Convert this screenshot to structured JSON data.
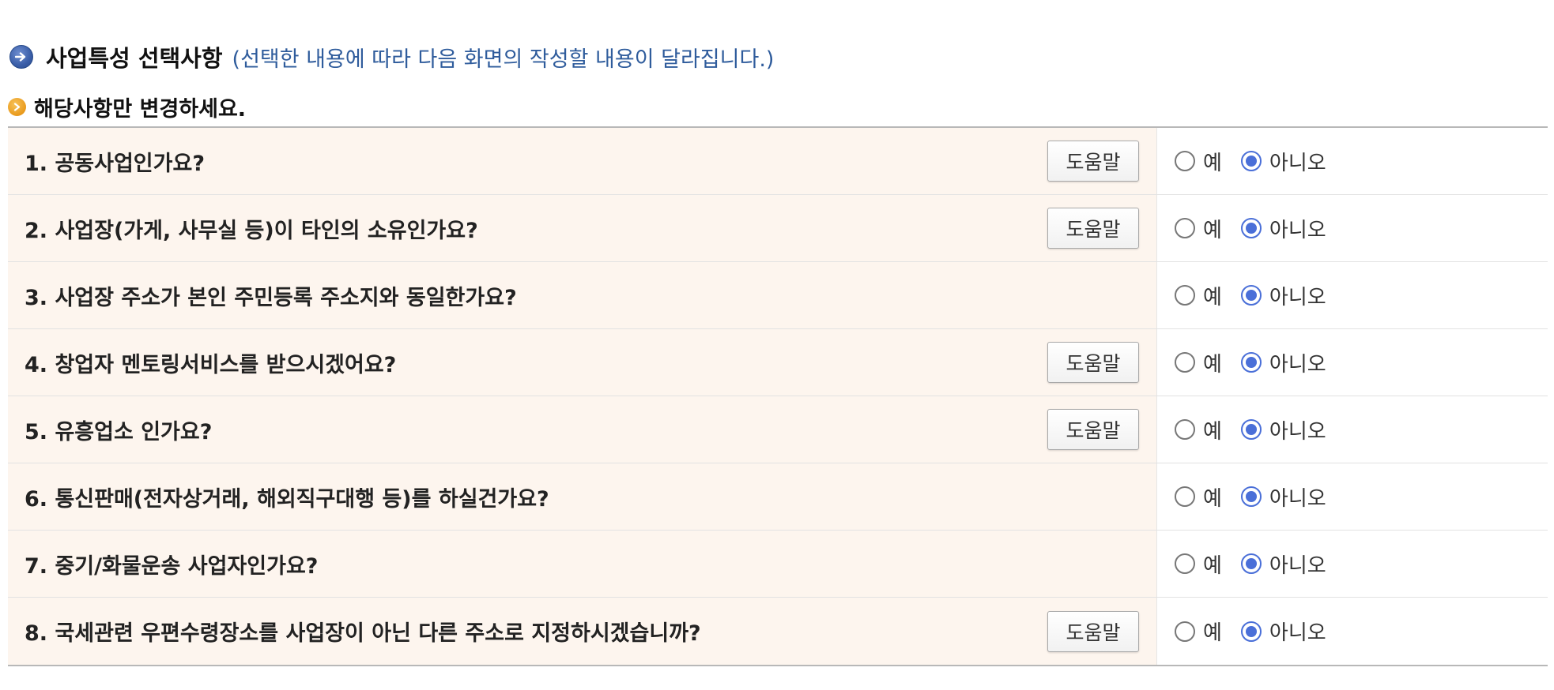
{
  "section": {
    "icon": "arrow-right-circle-icon",
    "title": "사업특성 선택사항",
    "note": "(선택한 내용에 따라 다음 화면의 작성할 내용이 달라집니다.)"
  },
  "subheading": {
    "icon": "arrow-right-dot-icon",
    "text": "해당사항만 변경하세요."
  },
  "options": {
    "yes_label": "예",
    "no_label": "아니오"
  },
  "help_label": "도움말",
  "questions": [
    {
      "text": "1. 공동사업인가요?",
      "has_help": true,
      "selected": "no"
    },
    {
      "text": "2. 사업장(가게, 사무실 등)이 타인의 소유인가요?",
      "has_help": true,
      "selected": "no"
    },
    {
      "text": "3. 사업장 주소가 본인 주민등록 주소지와 동일한가요?",
      "has_help": false,
      "selected": "no"
    },
    {
      "text": "4. 창업자 멘토링서비스를 받으시겠어요?",
      "has_help": true,
      "selected": "no"
    },
    {
      "text": "5. 유흥업소 인가요?",
      "has_help": true,
      "selected": "no"
    },
    {
      "text": "6. 통신판매(전자상거래, 해외직구대행 등)를 하실건가요?",
      "has_help": false,
      "selected": "no"
    },
    {
      "text": "7. 중기/화물운송 사업자인가요?",
      "has_help": false,
      "selected": "no"
    },
    {
      "text": "8. 국세관련 우편수령장소를 사업장이 아닌 다른 주소로 지정하시겠습니까?",
      "has_help": true,
      "selected": "no"
    }
  ],
  "colors": {
    "question_bg": "#fdf5ee",
    "radio_accent": "#4a6fd8",
    "note_text": "#2f5c9c"
  }
}
